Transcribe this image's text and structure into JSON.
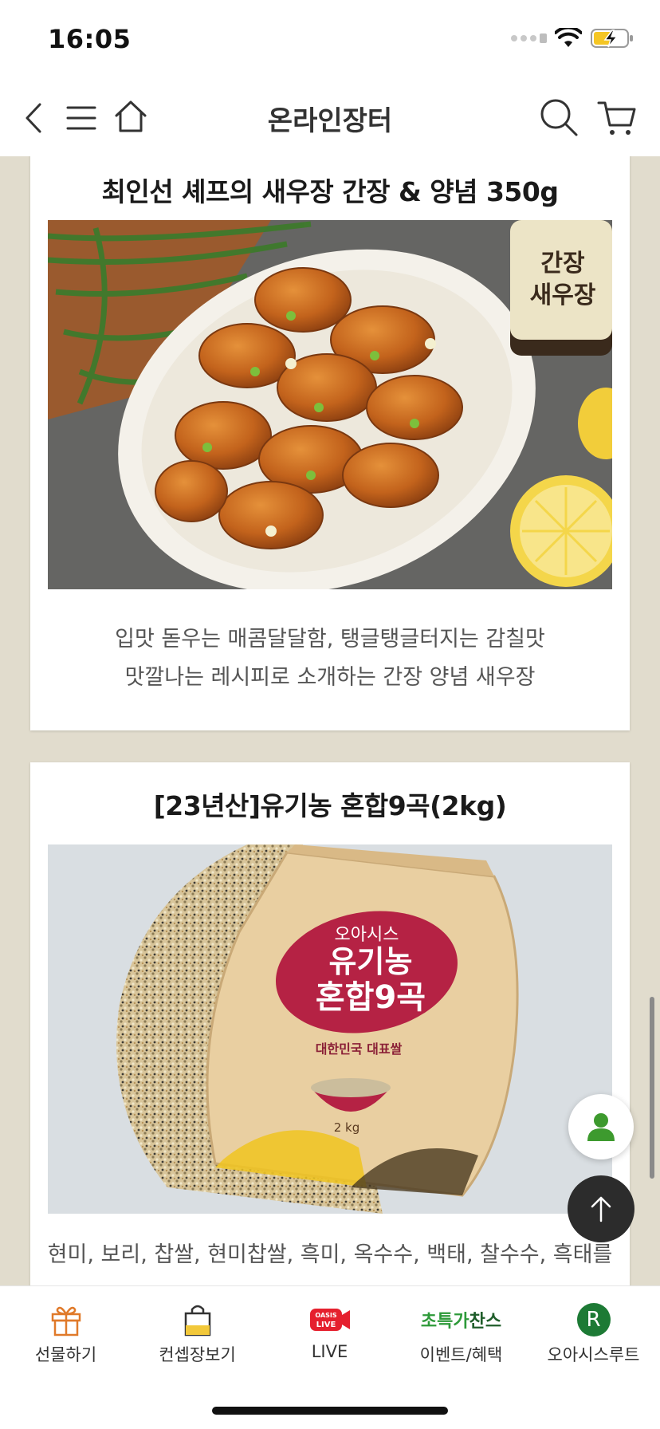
{
  "status_bar": {
    "time": "16:05"
  },
  "nav": {
    "title": "온라인장터"
  },
  "cards": [
    {
      "title": "최인선 셰프의 새우장 간장 & 양념 350g",
      "jar_label": "간장\n새우장",
      "desc_lines": [
        "입맛 돋우는 매콤달달함, 탱글탱글터지는 감칠맛",
        "맛깔나는 레시피로 소개하는 간장 양념 새우장"
      ]
    },
    {
      "title": "[23년산]유기농 혼합9곡(2kg)",
      "bag_brand": "오아시스",
      "bag_name_1": "유기농",
      "bag_name_2": "혼합9곡",
      "bag_sub": "대한민국 대표쌀",
      "bag_weight": "2 kg",
      "desc_lines": [
        "현미, 보리, 찹쌀, 현미찹쌀, 흑미, 옥수수, 백태, 찰수수, 흑태를"
      ]
    }
  ],
  "tabs": [
    {
      "label": "선물하기",
      "icon": "gift-icon"
    },
    {
      "label": "컨셉장보기",
      "icon": "shopping-bag-icon"
    },
    {
      "label": "LIVE",
      "icon": "oasis-live-icon",
      "badge_1": "OASIS",
      "badge_2": "LIVE"
    },
    {
      "label": "이벤트/혜택",
      "icon": "chance-logo-icon",
      "logo_green": "초특가",
      "logo_dark": "찬스"
    },
    {
      "label": "오아시스루트",
      "icon": "route-logo-icon",
      "logo_letter": "R"
    }
  ],
  "colors": {
    "background": "#e1dccd",
    "accent_green": "#2e9a3a",
    "live_red": "#e5202e",
    "route_green": "#1d7a35"
  }
}
